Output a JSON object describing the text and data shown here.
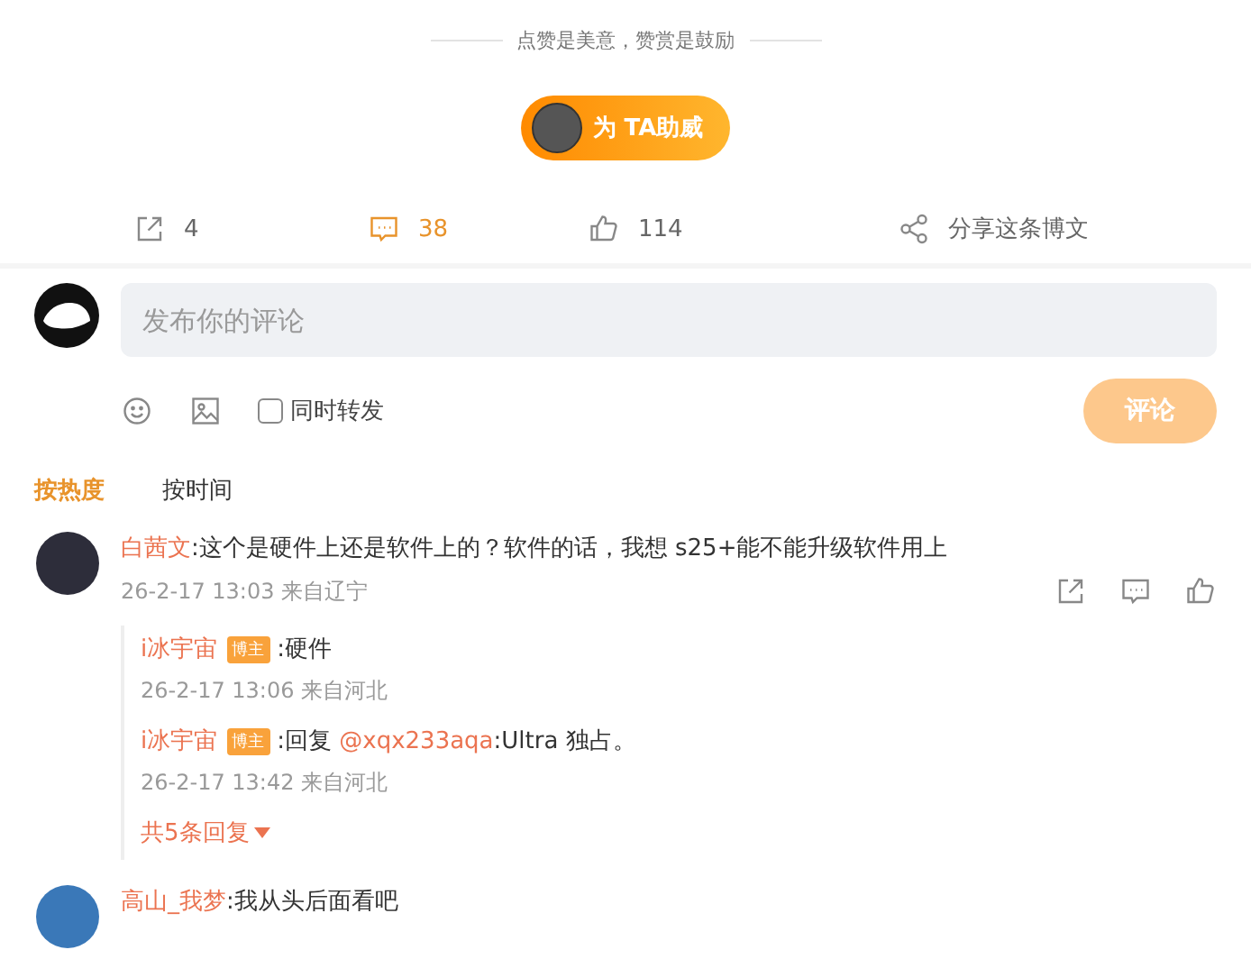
{
  "reward": {
    "caption": "点赞是美意，赞赏是鼓励",
    "button": "为 TA助威"
  },
  "actions": [
    {
      "kind": "repost",
      "label": "4",
      "selected": false
    },
    {
      "kind": "comment",
      "label": "38",
      "selected": true
    },
    {
      "kind": "like",
      "label": "114",
      "selected": false
    },
    {
      "kind": "share",
      "label": "分享这条博文",
      "selected": false
    }
  ],
  "composer": {
    "placeholder": "发布你的评论",
    "repost_label": "同时转发",
    "repost_checked": false,
    "submit": "评论",
    "submit_disabled": true
  },
  "sort_tabs": [
    {
      "label": "按热度",
      "selected": true
    },
    {
      "label": "按时间",
      "selected": false
    }
  ],
  "comments": [
    {
      "user": "白茜文",
      "text": ":这个是硬件上还是软件上的？软件的话，我想 s25+能不能升级软件用上",
      "meta": "26-2-17 13:03 来自辽宁",
      "replies": [
        {
          "user": "i冰宇宙",
          "badge": "博主",
          "text": ":硬件",
          "meta": "26-2-17 13:06 来自河北"
        },
        {
          "user": "i冰宇宙",
          "badge": "博主",
          "text": ":回复 ",
          "mention": "@xqx233aqa",
          "tail": ":Ultra 独占。",
          "meta": "26-2-17 13:42 来自河北"
        }
      ],
      "more": "共5条回复"
    },
    {
      "user": "高山_我梦",
      "text": ":我从头后面看吧"
    }
  ]
}
